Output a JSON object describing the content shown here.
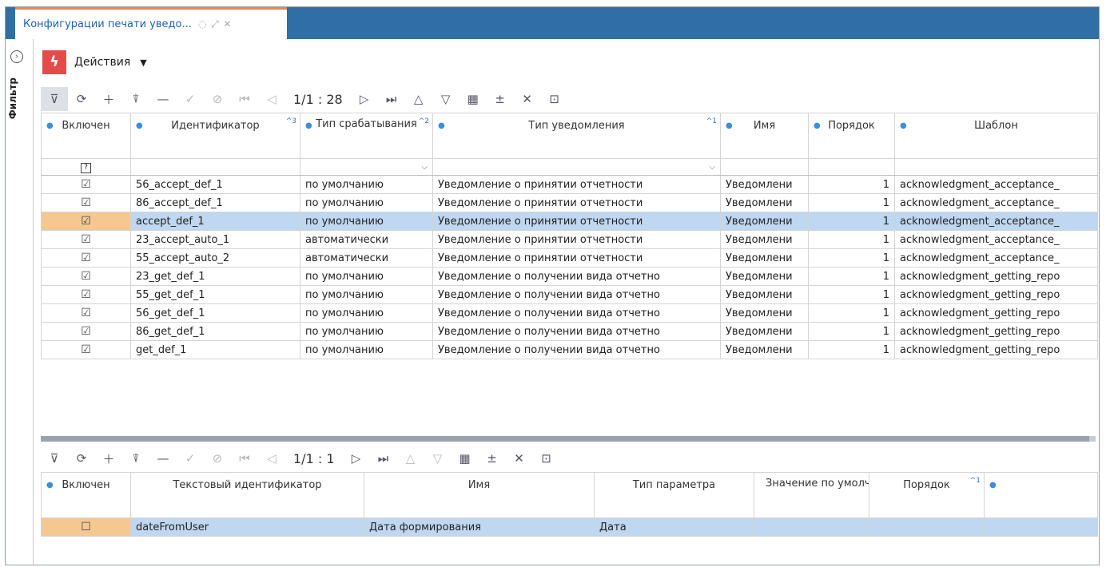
{
  "tab": {
    "title": "Конфигурации печати уведо...",
    "icons": "◌ ⤢ ✕"
  },
  "sidebar": {
    "filter_label": "Фильтр",
    "expand_glyph": "›"
  },
  "actions": {
    "label": "Действия",
    "icon": "lightning-icon"
  },
  "toolbar_top": {
    "pager": "1/1 : 28"
  },
  "toolbar_bottom": {
    "pager": "1/1 : 1"
  },
  "main_table": {
    "columns": [
      {
        "label": "Включен",
        "sort": ""
      },
      {
        "label": "Идентификатор",
        "sort": "^3"
      },
      {
        "label": "Тип срабатывания",
        "sort": "^2"
      },
      {
        "label": "Тип уведомления",
        "sort": "^1"
      },
      {
        "label": "Имя",
        "sort": ""
      },
      {
        "label": "Порядок",
        "sort": ""
      },
      {
        "label": "Шаблон",
        "sort": ""
      }
    ],
    "filter_check": "?",
    "rows": [
      {
        "checked": "☑",
        "id": "56_accept_def_1",
        "trigger": "по умолчанию",
        "type": "Уведомление о принятии отчетности",
        "name": "Уведомлени",
        "order": "1",
        "template": "acknowledgment_acceptance_"
      },
      {
        "checked": "☑",
        "id": "86_accept_def_1",
        "trigger": "по умолчанию",
        "type": "Уведомление о принятии отчетности",
        "name": "Уведомлени",
        "order": "1",
        "template": "acknowledgment_acceptance_"
      },
      {
        "checked": "☑",
        "id": "accept_def_1",
        "trigger": "по умолчанию",
        "type": "Уведомление о принятии отчетности",
        "name": "Уведомлени",
        "order": "1",
        "template": "acknowledgment_acceptance_"
      },
      {
        "checked": "☑",
        "id": "23_accept_auto_1",
        "trigger": "автоматически",
        "type": "Уведомление о принятии отчетности",
        "name": "Уведомлени",
        "order": "1",
        "template": "acknowledgment_acceptance_"
      },
      {
        "checked": "☑",
        "id": "55_accept_auto_2",
        "trigger": "автоматически",
        "type": "Уведомление о принятии отчетности",
        "name": "Уведомлени",
        "order": "1",
        "template": "acknowledgment_acceptance_"
      },
      {
        "checked": "☑",
        "id": "23_get_def_1",
        "trigger": "по умолчанию",
        "type": "Уведомление о получении вида отчетно",
        "name": "Уведомлени",
        "order": "1",
        "template": "acknowledgment_getting_repo"
      },
      {
        "checked": "☑",
        "id": "55_get_def_1",
        "trigger": "по умолчанию",
        "type": "Уведомление о получении вида отчетно",
        "name": "Уведомлени",
        "order": "1",
        "template": "acknowledgment_getting_repo"
      },
      {
        "checked": "☑",
        "id": "56_get_def_1",
        "trigger": "по умолчанию",
        "type": "Уведомление о получении вида отчетно",
        "name": "Уведомлени",
        "order": "1",
        "template": "acknowledgment_getting_repo"
      },
      {
        "checked": "☑",
        "id": "86_get_def_1",
        "trigger": "по умолчанию",
        "type": "Уведомление о получении вида отчетно",
        "name": "Уведомлени",
        "order": "1",
        "template": "acknowledgment_getting_repo"
      },
      {
        "checked": "☑",
        "id": "get_def_1",
        "trigger": "по умолчанию",
        "type": "Уведомление о получении вида отчетно",
        "name": "Уведомлени",
        "order": "1",
        "template": "acknowledgment_getting_repo"
      }
    ],
    "selected_index": 2
  },
  "sub_table": {
    "columns": [
      {
        "label": "Включен"
      },
      {
        "label": "Текстовый идентификатор"
      },
      {
        "label": "Имя"
      },
      {
        "label": "Тип параметра"
      },
      {
        "label": "Значение по умолчанию"
      },
      {
        "label": "Порядок",
        "sort": "^1"
      }
    ],
    "rows": [
      {
        "checked": "☐",
        "id": "dateFromUser",
        "name": "Дата формирования",
        "ptype": "Дата",
        "default": "",
        "order": ""
      }
    ]
  },
  "colors": {
    "tabbar": "#2f6fa6",
    "selection": "#bfd7f0",
    "selection_marker": "#f5c892",
    "accent": "#e54b4b"
  }
}
